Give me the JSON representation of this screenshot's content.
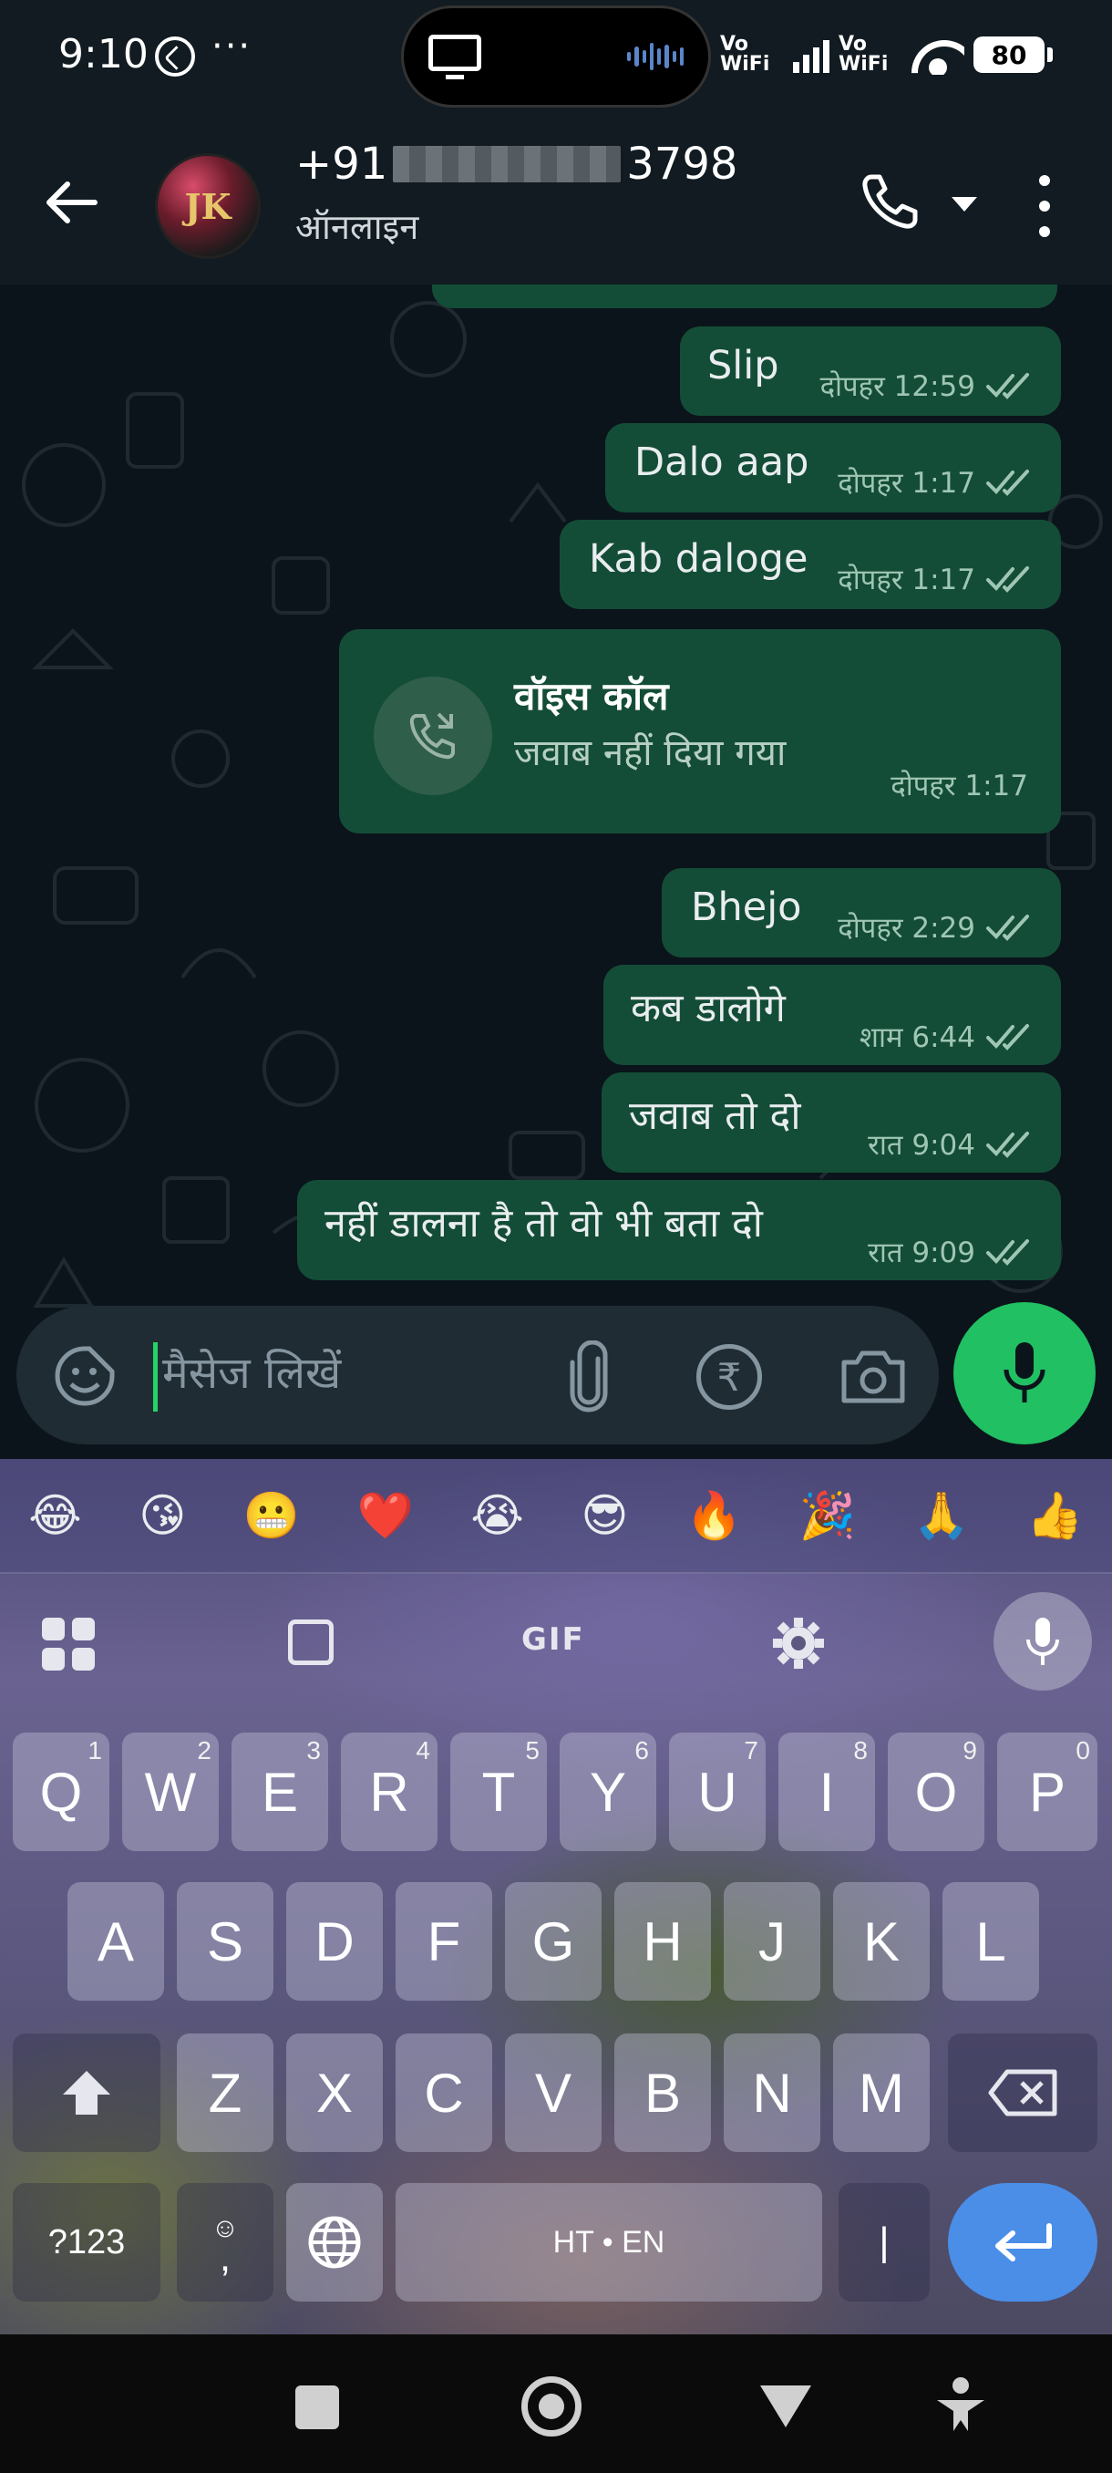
{
  "status_bar": {
    "time": "9:10",
    "more": "···",
    "vowifi_1": "Vo WiFi",
    "vowifi_2": "Vo WiFi",
    "battery": "80"
  },
  "header": {
    "name_prefix": "+91",
    "name_suffix": "3798",
    "status": "ऑनलाइन",
    "avatar_logo": "JK"
  },
  "messages": [
    {
      "text": "Slip",
      "time": "दोपहर 12:59"
    },
    {
      "text": "Dalo aap",
      "time": "दोपहर 1:17"
    },
    {
      "text": "Kab daloge",
      "time": "दोपहर 1:17"
    },
    {
      "text": "Bhejo",
      "time": "दोपहर 2:29"
    },
    {
      "text": "कब डालोगे",
      "time": "शाम 6:44"
    },
    {
      "text": "जवाब तो दो",
      "time": "रात 9:04"
    },
    {
      "text": "नहीं डालना है तो वो भी बता दो",
      "time": "रात 9:09"
    }
  ],
  "call_message": {
    "title": "वॉइस कॉल",
    "subtitle": "जवाब नहीं दिया गया",
    "time": "दोपहर 1:17"
  },
  "input": {
    "placeholder": "मैसेज लिखें",
    "rupee_symbol": "₹"
  },
  "keyboard": {
    "emoji_row": [
      "😂",
      "😘",
      "😬",
      "❤️",
      "😭",
      "😎",
      "🔥",
      "🎉",
      "🙏",
      "👍"
    ],
    "gif_label": "GIF",
    "row1": [
      {
        "key": "Q",
        "hint": "1"
      },
      {
        "key": "W",
        "hint": "2"
      },
      {
        "key": "E",
        "hint": "3"
      },
      {
        "key": "R",
        "hint": "4"
      },
      {
        "key": "T",
        "hint": "5"
      },
      {
        "key": "Y",
        "hint": "6"
      },
      {
        "key": "U",
        "hint": "7"
      },
      {
        "key": "I",
        "hint": "8"
      },
      {
        "key": "O",
        "hint": "9"
      },
      {
        "key": "P",
        "hint": "0"
      }
    ],
    "row2": [
      "A",
      "S",
      "D",
      "F",
      "G",
      "H",
      "J",
      "K",
      "L"
    ],
    "row3": [
      "Z",
      "X",
      "C",
      "V",
      "B",
      "N",
      "M"
    ],
    "symbols_label": "?123",
    "comma_label": ",",
    "space_label": "HT • EN",
    "pipe_label": "|"
  },
  "colors": {
    "outgoing_bubble": "#144d37",
    "accent_green": "#21c063",
    "chat_bg": "#0b141a",
    "header_bg": "#111b21",
    "enter_key": "#4a8ee8"
  }
}
